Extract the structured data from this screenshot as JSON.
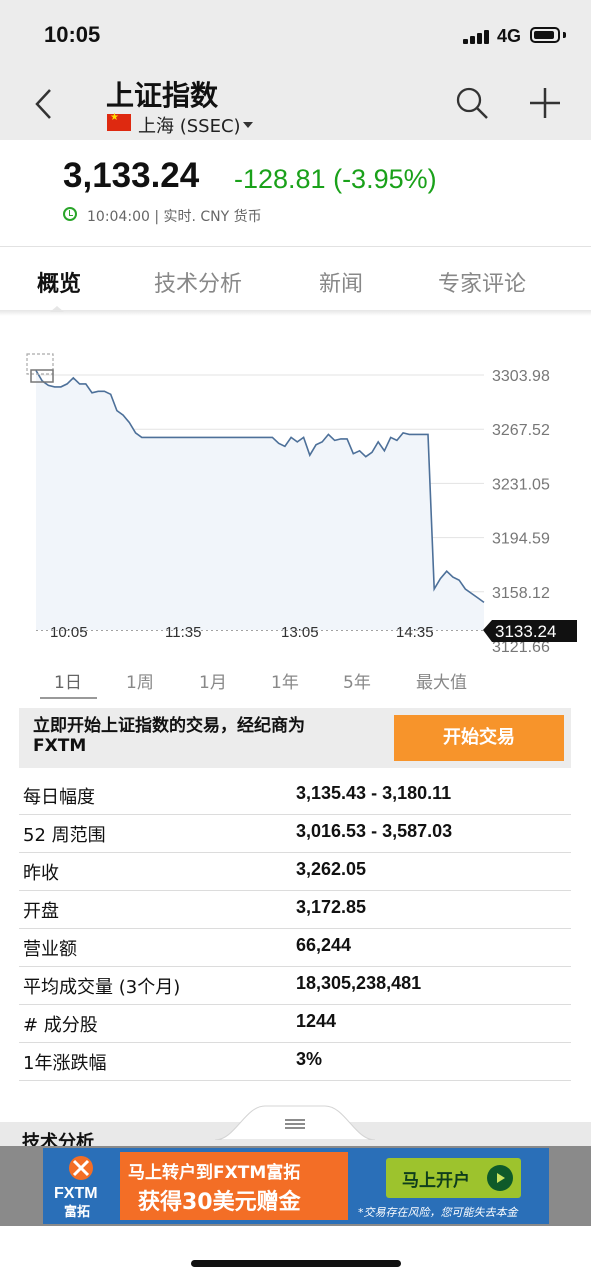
{
  "status_bar": {
    "time": "10:05",
    "network": "4G"
  },
  "header": {
    "title": "上证指数",
    "exchange": "上海 (SSEC)",
    "flag_icon": "china-flag-icon",
    "icons": [
      "back-chevron-icon",
      "search-icon",
      "plus-icon"
    ]
  },
  "quote": {
    "price": "3,133.24",
    "change": "-128.81 (-3.95%)",
    "time_info": "10:04:00 | 实时.  CNY 货币",
    "change_color": "#1aa11a"
  },
  "tabs": [
    {
      "label": "概览",
      "active": true
    },
    {
      "label": "技术分析",
      "active": false
    },
    {
      "label": "新闻",
      "active": false
    },
    {
      "label": "专家评论",
      "active": false
    }
  ],
  "chart_data": {
    "type": "area",
    "y_ticks": [
      "3303.98",
      "3267.52",
      "3231.05",
      "3194.59",
      "3158.12",
      "3121.66"
    ],
    "x_ticks": [
      "10:05",
      "11:35",
      "13:05",
      "14:35"
    ],
    "ylim": [
      3121.66,
      3303.98
    ],
    "last_value_label": "3133.24",
    "line_color": "#4d7099",
    "fill_color": "#f1f5fa",
    "series": [
      {
        "values": [
          3307,
          3300,
          3297,
          3296,
          3296,
          3298,
          3302,
          3298,
          3298,
          3292,
          3293,
          3293,
          3291,
          3280,
          3277,
          3272,
          3265,
          3262,
          3262,
          3262,
          3262,
          3262,
          3262,
          3262,
          3262,
          3262,
          3262,
          3262,
          3262,
          3262,
          3262,
          3262,
          3262,
          3262,
          3262,
          3262,
          3262,
          3262,
          3262,
          3258,
          3256,
          3262,
          3259,
          3262,
          3250,
          3257,
          3259,
          3264,
          3260,
          3261,
          3261,
          3251,
          3253,
          3249,
          3252,
          3259,
          3253,
          3262,
          3260,
          3265,
          3264,
          3264,
          3264,
          3264,
          3160,
          3167,
          3172,
          3168,
          3166,
          3160,
          3157,
          3154,
          3151
        ]
      }
    ]
  },
  "periods": [
    "1日",
    "1周",
    "1月",
    "1年",
    "5年",
    "最大值"
  ],
  "promo": {
    "text": "立即开始上证指数的交易，经纪商为FXTM",
    "button": "开始交易"
  },
  "stats": [
    {
      "label": "每日幅度",
      "value": "3,135.43 - 3,180.11"
    },
    {
      "label": "52 周范围",
      "value": "3,016.53 - 3,587.03"
    },
    {
      "label": "昨收",
      "value": "3,262.05"
    },
    {
      "label": "开盘",
      "value": "3,172.85"
    },
    {
      "label": "营业额",
      "value": "66,244"
    },
    {
      "label": "平均成交量 (3个月)",
      "value": "18,305,238,481"
    },
    {
      "label": "# 成分股",
      "value": "1244"
    },
    {
      "label": "1年涨跌幅",
      "value": "3%"
    }
  ],
  "next_section": "技术分析",
  "ad": {
    "brand": "FXTM",
    "brand_cn": "富拓",
    "line1": "马上转户到FXTM富拓",
    "line2": "获得30美元赠金",
    "button": "马上开户",
    "risk": "*交易存在风险，您可能失去本金",
    "brand_color": "#2a6fb8",
    "offer_color": "#f36e26"
  }
}
